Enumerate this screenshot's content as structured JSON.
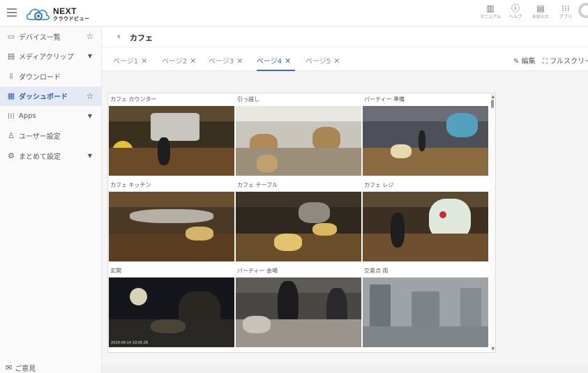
{
  "app": {
    "logo_name": "NEXT",
    "logo_sub": "クラウドビュー"
  },
  "top_actions": [
    {
      "icon": "manual-icon",
      "label": "マニュアル"
    },
    {
      "icon": "help-icon",
      "label": "ヘルプ"
    },
    {
      "icon": "news-icon",
      "label": "お知らせ"
    },
    {
      "icon": "apps-grid-icon",
      "label": "アプリ"
    }
  ],
  "sidebar": {
    "items": [
      {
        "icon": "device-list-icon",
        "label": "デバイス一覧",
        "end": "star"
      },
      {
        "icon": "media-clip-icon",
        "label": "メディアクリップ",
        "end": "caret"
      },
      {
        "icon": "download-icon",
        "label": "ダウンロード",
        "end": ""
      },
      {
        "icon": "dashboard-icon",
        "label": "ダッシュボード",
        "end": "star",
        "active": true
      },
      {
        "icon": "apps-icon",
        "label": "Apps",
        "end": "caret"
      },
      {
        "icon": "user-settings-icon",
        "label": "ユーザー設定",
        "end": ""
      },
      {
        "icon": "bulk-settings-icon",
        "label": "まとめて設定",
        "end": "caret"
      }
    ],
    "feedback_label": "ご意見"
  },
  "header": {
    "title": "カフェ"
  },
  "tabs": [
    {
      "label": "ページ1"
    },
    {
      "label": "ページ2"
    },
    {
      "label": "ページ3"
    },
    {
      "label": "ページ4",
      "active": true
    },
    {
      "label": "ページ5"
    }
  ],
  "tab_actions": {
    "edit_label": "編集",
    "fullscreen_label": "フルスクリー"
  },
  "cameras": [
    {
      "name": "カフェ カウンター"
    },
    {
      "name": "引っ越し"
    },
    {
      "name": "パーティー 準備"
    },
    {
      "name": "カフェ キッチン"
    },
    {
      "name": "カフェ テーブル"
    },
    {
      "name": "カフェ レジ"
    },
    {
      "name": "玄関",
      "stamp": "2019-08-14 19:05:28"
    },
    {
      "name": "パーティー 会場"
    },
    {
      "name": "交差点 雨"
    }
  ],
  "colors": {
    "accent": "#3b67b3",
    "active_bg": "#e4e9f3"
  }
}
